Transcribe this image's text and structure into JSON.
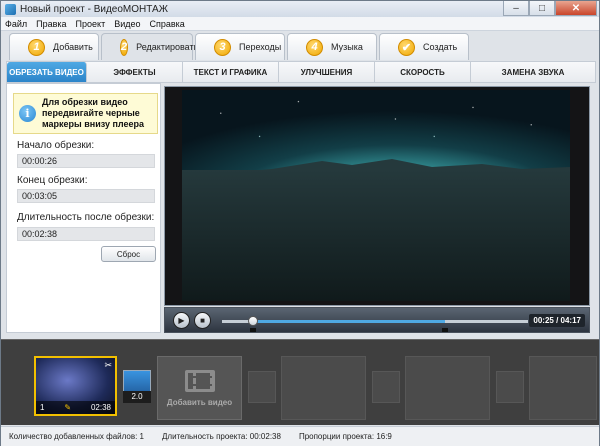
{
  "window": {
    "title": "Новый проект - ВидеоМОНТАЖ",
    "controls": {
      "minimize": "–",
      "maximize": "□",
      "close": "✕"
    }
  },
  "menu": [
    "Файл",
    "Правка",
    "Проект",
    "Видео",
    "Справка"
  ],
  "steps": [
    {
      "num": "1",
      "label": "Добавить",
      "active": false
    },
    {
      "num": "2",
      "label": "Редактировать",
      "active": true
    },
    {
      "num": "3",
      "label": "Переходы",
      "active": false
    },
    {
      "num": "4",
      "label": "Музыка",
      "active": false
    },
    {
      "num": "✔",
      "label": "Создать",
      "active": false
    }
  ],
  "subtabs": [
    {
      "label": "ОБРЕЗАТЬ ВИДЕО",
      "active": true
    },
    {
      "label": "ЭФФЕКТЫ",
      "active": false
    },
    {
      "label": "ТЕКСТ И ГРАФИКА",
      "active": false
    },
    {
      "label": "УЛУЧШЕНИЯ",
      "active": false
    },
    {
      "label": "СКОРОСТЬ",
      "active": false
    },
    {
      "label": "ЗАМЕНА ЗВУКА",
      "active": false
    }
  ],
  "trim": {
    "hint": "Для обрезки видео передвигайте черные маркеры внизу плеера",
    "start_label": "Начало обрезки:",
    "start_value": "00:00:26",
    "end_label": "Конец обрезки:",
    "end_value": "00:03:05",
    "duration_label": "Длительность после обрезки:",
    "duration_value": "00:02:38",
    "reset_label": "Сброс"
  },
  "player": {
    "time_display": "00:25 / 04:17",
    "progress": 0.1,
    "trim_start": 0.1,
    "trim_end": 0.73
  },
  "storyboard": {
    "clip_index": "1",
    "clip_duration": "02:38",
    "transition_duration": "2.0",
    "add_video_label": "Добавить видео"
  },
  "status": {
    "files_count": "Количество добавленных файлов: 1",
    "project_duration": "Длительность проекта: 00:02:38",
    "aspect": "Пропорции проекта: 16:9"
  },
  "colors": {
    "accent": "#2b84c9",
    "step_badge": "#f0a800",
    "selected_clip_border": "#f2c000"
  }
}
